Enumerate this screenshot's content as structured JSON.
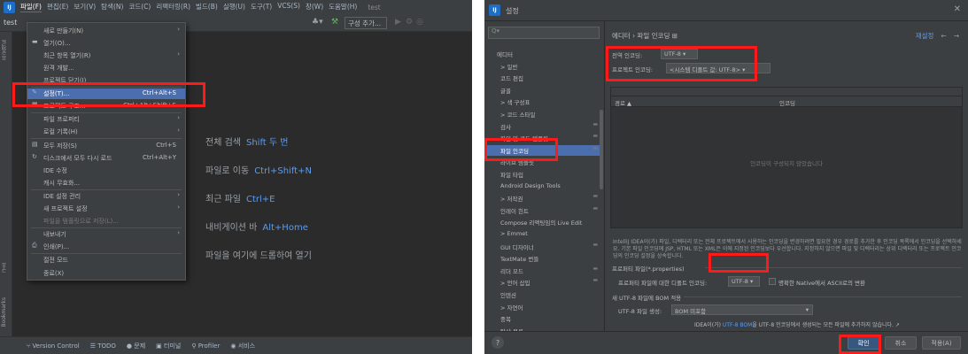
{
  "ide": {
    "logo": "IJ",
    "menubar": [
      "파일(F)",
      "편집(E)",
      "보기(V)",
      "탐색(N)",
      "코드(C)",
      "리팩터링(R)",
      "빌드(B)",
      "실행(U)",
      "도구(T)",
      "VCS(S)",
      "창(W)",
      "도움말(H)"
    ],
    "window_title": "test",
    "project_label": "test",
    "config_label": "구성 추가...",
    "file_menu": {
      "items": [
        {
          "label": "새로 만들기(N)",
          "shortcut": "",
          "submenu": true
        },
        {
          "label": "열기(O)...",
          "shortcut": "",
          "icon": "folder-icon"
        },
        {
          "label": "최근 항목 열기(R)",
          "shortcut": "",
          "submenu": true
        },
        {
          "label": "원격 개발...",
          "shortcut": ""
        },
        {
          "label": "프로젝트 닫기(J)",
          "shortcut": ""
        },
        {
          "label": "설정(T)...",
          "shortcut": "Ctrl+Alt+S",
          "icon": "wrench-icon"
        },
        {
          "label": "프로젝트 구조...",
          "shortcut": "Ctrl+Alt+Shift+S",
          "icon": "structure-icon"
        },
        {
          "label": "파일 프로퍼티",
          "shortcut": "",
          "submenu": true
        },
        {
          "label": "로컬 기록(H)",
          "shortcut": "",
          "submenu": true
        },
        {
          "label": "모두 저장(S)",
          "shortcut": "Ctrl+S",
          "icon": "save-icon"
        },
        {
          "label": "디스크에서 모두 다시 로드",
          "shortcut": "Ctrl+Alt+Y",
          "icon": "reload-icon"
        },
        {
          "label": "IDE 수정",
          "shortcut": ""
        },
        {
          "label": "캐시 무효화...",
          "shortcut": ""
        },
        {
          "label": "IDE 설정 관리",
          "shortcut": "",
          "submenu": true
        },
        {
          "label": "새 프로젝트 설정",
          "shortcut": "",
          "submenu": true
        },
        {
          "label": "파일을 템플릿으로 저장(L)...",
          "shortcut": ""
        },
        {
          "label": "내보내기",
          "shortcut": "",
          "submenu": true
        },
        {
          "label": "인쇄(P)...",
          "shortcut": "",
          "icon": "print-icon"
        },
        {
          "label": "절전 모드",
          "shortcut": ""
        },
        {
          "label": "종료(X)",
          "shortcut": ""
        }
      ]
    },
    "hints": [
      {
        "text": "전체 검색",
        "key": "Shift 두 번"
      },
      {
        "text": "파일로 이동",
        "key": "Ctrl+Shift+N"
      },
      {
        "text": "최근 파일",
        "key": "Ctrl+E"
      },
      {
        "text": "내비게이션 바",
        "key": "Alt+Home"
      },
      {
        "text": "파일을 여기에 드롭하여 열기",
        "key": ""
      }
    ],
    "bottom_tools": [
      "Version Control",
      "TODO",
      "문제",
      "터미널",
      "Profiler",
      "서비스"
    ],
    "strip": [
      "프로젝트",
      "구조",
      "Bookmarks"
    ]
  },
  "settings": {
    "logo": "IJ",
    "title": "설정",
    "search_placeholder": "Q▾",
    "tree": [
      {
        "label": "에디터",
        "indent": 0,
        "expanded": true
      },
      {
        "label": "> 일반",
        "indent": 1
      },
      {
        "label": "코드 편집",
        "indent": 1
      },
      {
        "label": "글꼴",
        "indent": 1
      },
      {
        "label": "> 색 구성표",
        "indent": 1
      },
      {
        "label": "> 코드 스타일",
        "indent": 1
      },
      {
        "label": "검사",
        "indent": 1,
        "pin": true
      },
      {
        "label": "파일 및 코드 템플릿",
        "indent": 1,
        "pin": true
      },
      {
        "label": "파일 인코딩",
        "indent": 1,
        "pin": true,
        "selected": true
      },
      {
        "label": "라이브 템플릿",
        "indent": 1
      },
      {
        "label": "파일 타입",
        "indent": 1
      },
      {
        "label": "Android Design Tools",
        "indent": 1
      },
      {
        "label": "> 저작권",
        "indent": 1,
        "pin": true
      },
      {
        "label": "인레이 힌트",
        "indent": 1,
        "pin": true
      },
      {
        "label": "Compose 리액팅임의 Live Edit",
        "indent": 1
      },
      {
        "label": "> Emmet",
        "indent": 1
      },
      {
        "label": "GUI 디자이너",
        "indent": 1,
        "pin": true
      },
      {
        "label": "TextMate 번들",
        "indent": 1
      },
      {
        "label": "리더 모드",
        "indent": 1,
        "pin": true
      },
      {
        "label": "> 언어 삽입",
        "indent": 1,
        "pin": true
      },
      {
        "label": "인텐션",
        "indent": 1
      },
      {
        "label": "> 자연어",
        "indent": 1
      },
      {
        "label": "중복",
        "indent": 1
      },
      {
        "label": "탐상 목록",
        "indent": 1
      }
    ],
    "breadcrumb": "에디터 › 파일 인코딩 ⊞",
    "reset_label": "재설정",
    "global_encoding_label": "전역 인코딩:",
    "global_encoding_value": "UTF-8 ▾",
    "project_encoding_label": "프로젝트 인코딩:",
    "project_encoding_value": "<시스템 디폴트 값: UTF-8> ▾",
    "table_col_path": "경로 ▲",
    "table_col_encoding": "인코딩",
    "table_empty": "인코딩이 구성되지 않았습니다",
    "description": "IntelliJ IDEA이(가) 파일, 디렉터리 또는 전체 프로젝트에서 사용하는 인코딩을 변경하려면 필요한 경우 경로를 추가한 후 인코딩 목록에서 인코딩을 선택하세요. 기본 파일 인코딩에 JSP, HTML 또는 XML은 이에 지정된 인코딩보다 우선합니다. 지정하지 않으면 파일 및 디렉터리는 상위 디렉터리 또는 프로젝트 인코딩의 인코딩 설정을 상속합니다.",
    "properties_section": "프로퍼티 파일(*.properties)",
    "properties_default_label": "프로퍼티 파일에 대한 디폴트 인코딩:",
    "properties_default_value": "UTF-8 ▾",
    "native_ascii_label": "명확한 Native에서 ASCII로의 변환",
    "bom_section": "새 UTF-8 파일에 BOM 적용",
    "bom_label": "UTF-8 파일 생성:",
    "bom_value": "BOM 미포함",
    "bom_note_prefix": "IDEA이(가)",
    "bom_note_link": "UTF-8 BOM",
    "bom_note_suffix": "을 UTF-8 인코딩에서 생성되는 모든 파일에 추가하지 않습니다. ↗",
    "help": "?",
    "ok": "확인",
    "cancel": "취소",
    "apply": "적용(A)"
  },
  "colors": {
    "highlight": "#ff1a1a",
    "selection": "#4b6eaf",
    "link": "#589df6"
  }
}
